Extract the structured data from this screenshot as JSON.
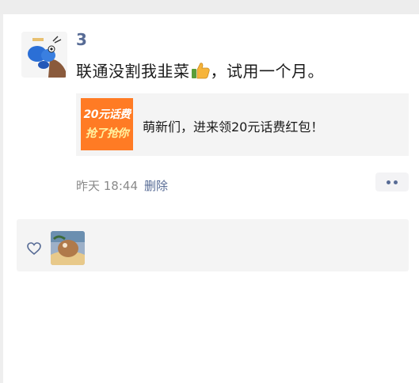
{
  "post": {
    "username": "3",
    "text_before_emoji": "联通没割我韭菜",
    "emoji": "thumbs-up",
    "text_after_emoji": "，试用一个月。",
    "link": {
      "thumb_line1": "20元话费",
      "thumb_line2": "抢了抢你",
      "title": "萌新们，进来领20元话费红包！"
    },
    "time": "昨天 18:44",
    "delete_label": "删除"
  },
  "likes": {
    "icon": "heart-outline-icon"
  },
  "colors": {
    "link_blue": "#576b95",
    "card_bg": "#f4f4f4",
    "accent_orange": "#ff7b24"
  }
}
